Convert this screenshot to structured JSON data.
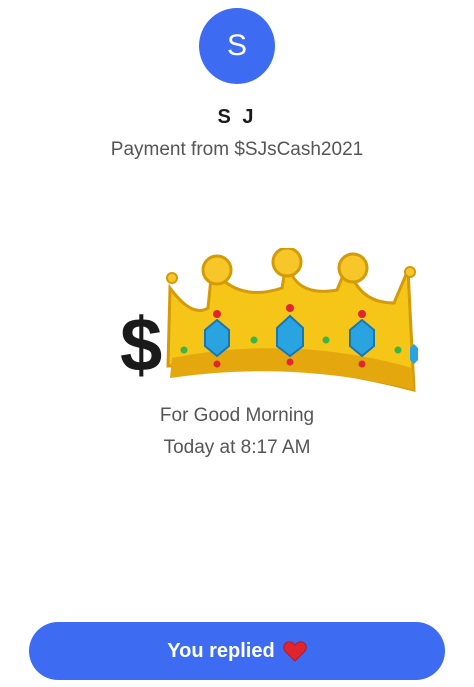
{
  "sender": {
    "avatar_initial": "S",
    "name": "S J",
    "subtitle": "Payment from $SJsCash2021"
  },
  "payment": {
    "currency_symbol": "$",
    "amount_icon": "crown-icon",
    "note": "For Good Morning",
    "time": "Today at 8:17 AM"
  },
  "reply_button": {
    "label": "You replied",
    "icon": "heart-icon"
  },
  "colors": {
    "accent": "#3d6cf2",
    "text_primary": "#1a1a1a",
    "text_secondary": "#555555",
    "crown_gold": "#f5c518",
    "gem_blue": "#2aa4e0",
    "heart_red": "#e0252f"
  }
}
